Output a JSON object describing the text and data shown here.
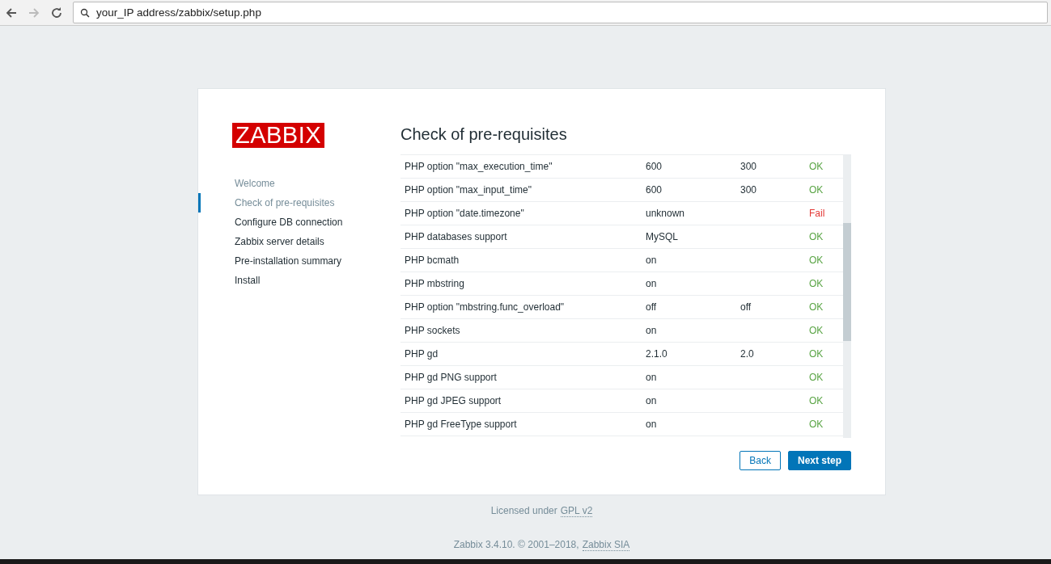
{
  "browser": {
    "address": "your_IP address/zabbix/setup.php"
  },
  "logo": "ZABBIX",
  "steps": [
    {
      "label": "Welcome",
      "visited": true,
      "selected": false
    },
    {
      "label": "Check of pre-requisites",
      "visited": true,
      "selected": true
    },
    {
      "label": "Configure DB connection",
      "visited": false,
      "selected": false
    },
    {
      "label": "Zabbix server details",
      "visited": false,
      "selected": false
    },
    {
      "label": "Pre-installation summary",
      "visited": false,
      "selected": false
    },
    {
      "label": "Install",
      "visited": false,
      "selected": false
    }
  ],
  "title": "Check of pre-requisites",
  "table": {
    "rows": [
      {
        "name": "PHP option \"max_execution_time\"",
        "current": "600",
        "required": "300",
        "result": "OK",
        "passed": true
      },
      {
        "name": "PHP option \"max_input_time\"",
        "current": "600",
        "required": "300",
        "result": "OK",
        "passed": true
      },
      {
        "name": "PHP option \"date.timezone\"",
        "current": "unknown",
        "required": "",
        "result": "Fail",
        "passed": false
      },
      {
        "name": "PHP databases support",
        "current": "MySQL",
        "required": "",
        "result": "OK",
        "passed": true
      },
      {
        "name": "PHP bcmath",
        "current": "on",
        "required": "",
        "result": "OK",
        "passed": true
      },
      {
        "name": "PHP mbstring",
        "current": "on",
        "required": "",
        "result": "OK",
        "passed": true
      },
      {
        "name": "PHP option \"mbstring.func_overload\"",
        "current": "off",
        "required": "off",
        "result": "OK",
        "passed": true
      },
      {
        "name": "PHP sockets",
        "current": "on",
        "required": "",
        "result": "OK",
        "passed": true
      },
      {
        "name": "PHP gd",
        "current": "2.1.0",
        "required": "2.0",
        "result": "OK",
        "passed": true
      },
      {
        "name": "PHP gd PNG support",
        "current": "on",
        "required": "",
        "result": "OK",
        "passed": true
      },
      {
        "name": "PHP gd JPEG support",
        "current": "on",
        "required": "",
        "result": "OK",
        "passed": true
      },
      {
        "name": "PHP gd FreeType support",
        "current": "on",
        "required": "",
        "result": "OK",
        "passed": true
      }
    ]
  },
  "buttons": {
    "back": "Back",
    "next": "Next step"
  },
  "footer": {
    "license_text": "Licensed under",
    "license_link": "GPL v2",
    "copyright_text": "Zabbix 3.4.10. © 2001–2018,",
    "company_link": "Zabbix SIA"
  }
}
